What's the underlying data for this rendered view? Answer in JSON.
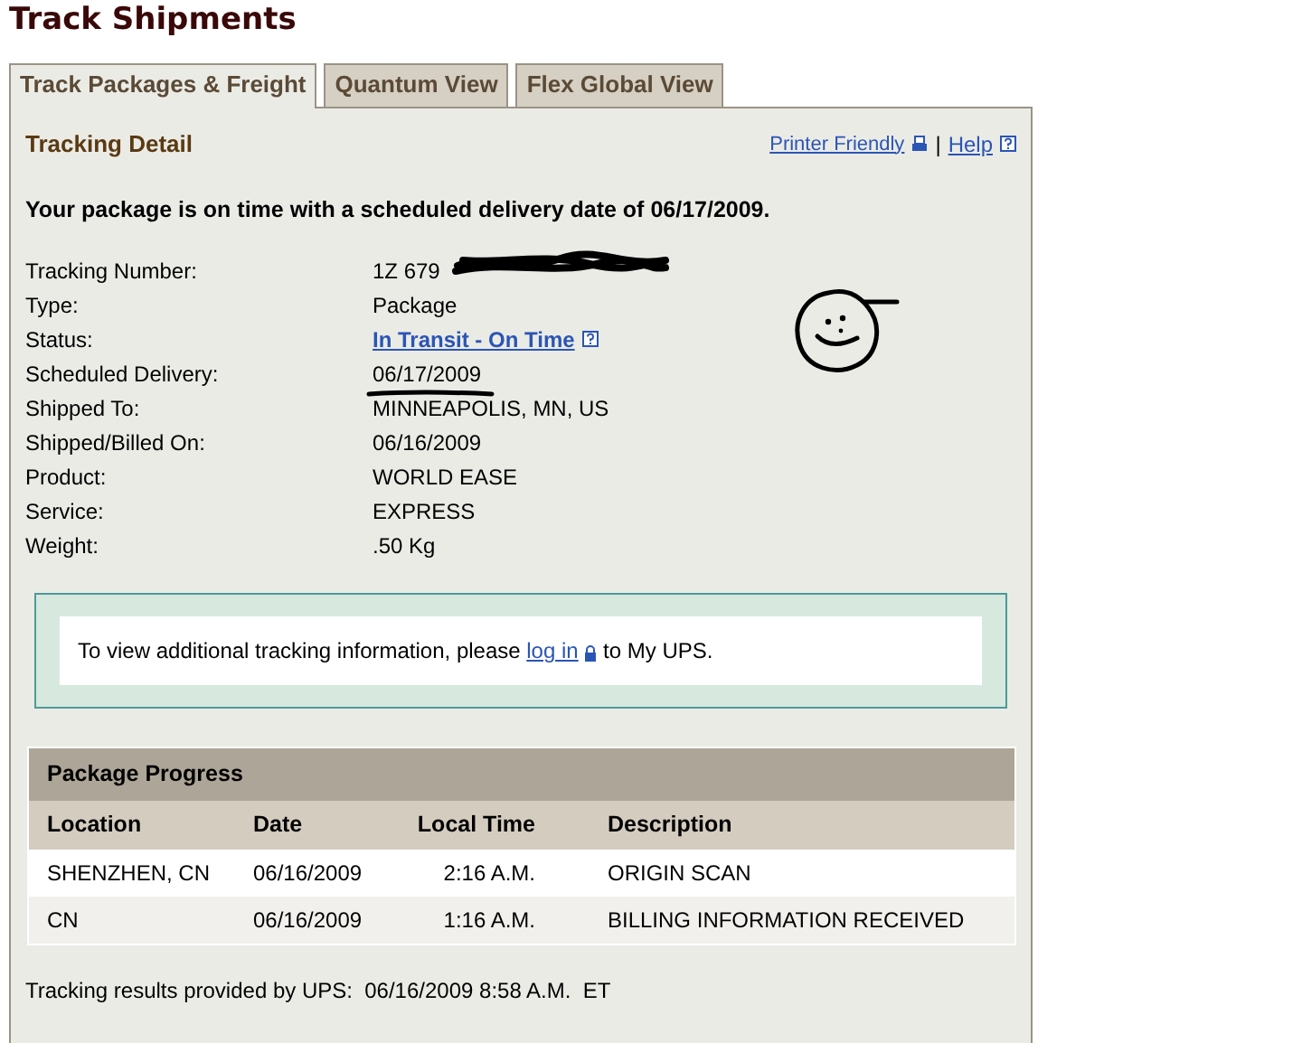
{
  "page_title": "Track Shipments",
  "tabs": [
    {
      "label": "Track Packages & Freight",
      "selected": true
    },
    {
      "label": "Quantum View",
      "selected": false
    },
    {
      "label": "Flex Global View",
      "selected": false
    }
  ],
  "section_title": "Tracking Detail",
  "header_links": [
    {
      "label": "Printer Friendly",
      "kind": "printer"
    },
    {
      "label": "Help",
      "kind": "help"
    }
  ],
  "header_separator": "|",
  "summary": "Your package is on time with a scheduled delivery date of 06/17/2009.",
  "details": [
    {
      "label": "Tracking Number:",
      "value": "1Z 679",
      "kind": "text",
      "redacted": true
    },
    {
      "label": "Type:",
      "value": "Package",
      "kind": "text"
    },
    {
      "label": "Status:",
      "value": "In Transit - On Time",
      "kind": "link"
    },
    {
      "label": "Scheduled Delivery:",
      "value": "06/17/2009",
      "kind": "text",
      "hand_underlined": true
    },
    {
      "label": "Shipped To:",
      "value": "MINNEAPOLIS, MN, US",
      "kind": "text"
    },
    {
      "label": "Shipped/Billed On:",
      "value": "06/16/2009",
      "kind": "text"
    },
    {
      "label": "Product:",
      "value": "WORLD EASE",
      "kind": "text"
    },
    {
      "label": "Service:",
      "value": "EXPRESS",
      "kind": "text"
    },
    {
      "label": "Weight:",
      "value": ".50 Kg",
      "kind": "text"
    }
  ],
  "login_notice": {
    "before": "To view additional tracking information, please",
    "link": "log in",
    "after": "to My UPS."
  },
  "progress": {
    "title": "Package Progress",
    "columns": [
      "Location",
      "Date",
      "Local Time",
      "Description"
    ],
    "rows": [
      [
        "SHENZHEN, CN",
        "06/16/2009",
        "2:16 A.M.",
        "ORIGIN SCAN"
      ],
      [
        "CN",
        "06/16/2009",
        "1:16 A.M.",
        "BILLING INFORMATION RECEIVED"
      ]
    ]
  },
  "footer": "Tracking results provided by UPS:  06/16/2009 8:58 A.M.  ET"
}
